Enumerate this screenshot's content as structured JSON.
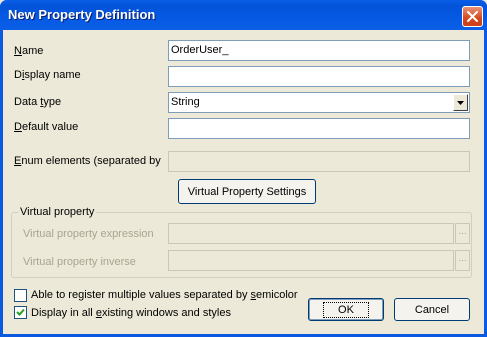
{
  "window": {
    "title": "New Property Definition"
  },
  "fields": {
    "name": {
      "label_pre": "",
      "label_key": "N",
      "label_post": "ame",
      "value": "OrderUser_"
    },
    "display_name": {
      "label_pre": "D",
      "label_key": "i",
      "label_post": "splay name",
      "value": ""
    },
    "data_type": {
      "label_pre": "Data ",
      "label_key": "t",
      "label_post": "ype",
      "value": "String"
    },
    "default_value": {
      "label_pre": "",
      "label_key": "D",
      "label_post": "efault value",
      "value": ""
    },
    "enum_elements": {
      "label_pre": "",
      "label_key": "E",
      "label_post": "num elements (separated by",
      "value": ""
    }
  },
  "virtual_settings_button": "Virtual Property Settings",
  "virtual_group": {
    "title": "Virtual property",
    "expression_label": "Virtual property expression",
    "inverse_label": "Virtual property inverse",
    "browse_label": "..."
  },
  "checkboxes": {
    "multiple_values": {
      "label_pre": "Able to register multiple values separated by ",
      "label_key": "s",
      "label_post": "emicolor",
      "checked": false
    },
    "display_all": {
      "label_pre": "Display in all ",
      "label_key": "e",
      "label_post": "xisting windows and styles",
      "checked": true
    }
  },
  "buttons": {
    "ok": "OK",
    "cancel": "Cancel"
  },
  "colors": {
    "title_bar": "#0A59E0",
    "dialog_bg": "#ECE9D8",
    "close_button": "#D5461C",
    "field_border": "#7F9DB9"
  }
}
